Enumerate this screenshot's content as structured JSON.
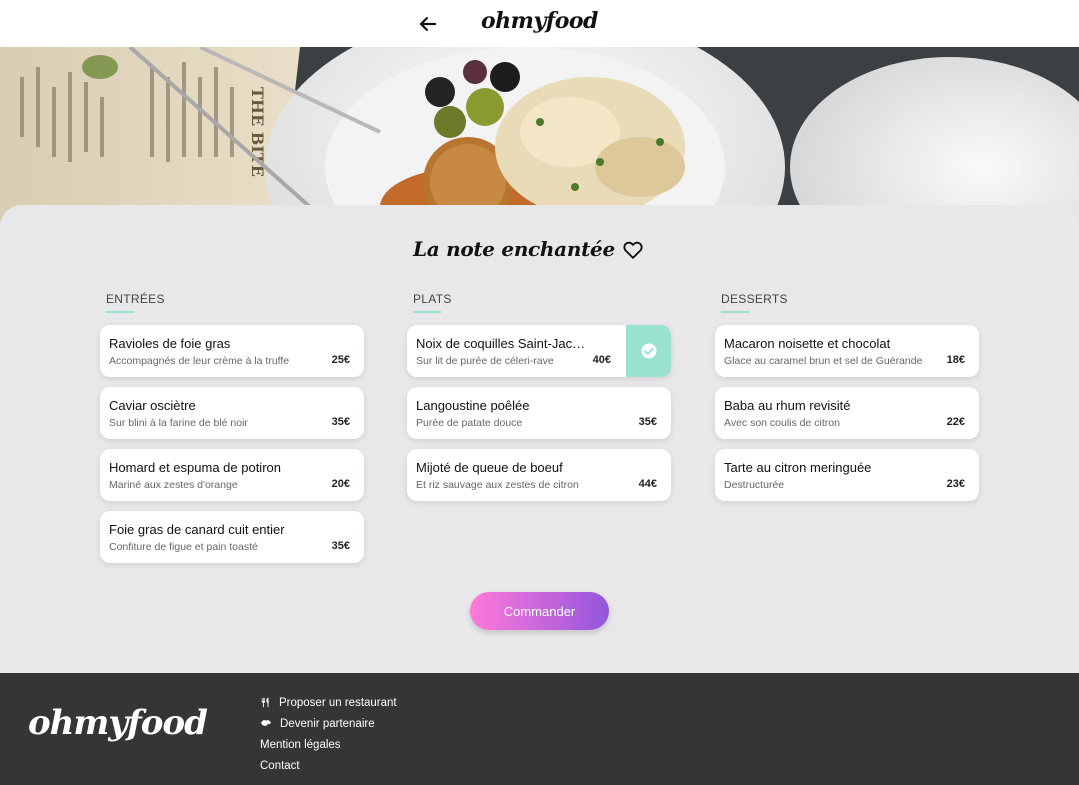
{
  "header": {
    "logo": "ohmyfood"
  },
  "page": {
    "title": "La note enchantée"
  },
  "columns": [
    {
      "title": "ENTRÉES",
      "items": [
        {
          "name": "Ravioles de foie gras",
          "desc": "Accompagnés de leur crème à la truffe",
          "price": "25€"
        },
        {
          "name": "Caviar osciètre",
          "desc": "Sur blini à la farine de blé noir",
          "price": "35€"
        },
        {
          "name": "Homard et espuma de potiron",
          "desc": "Mariné aux zestes d'orange",
          "price": "20€"
        },
        {
          "name": "Foie gras de canard cuit entier",
          "desc": "Confiture de figue et pain toasté",
          "price": "35€"
        }
      ]
    },
    {
      "title": "PLATS",
      "items": [
        {
          "name": "Noix de coquilles Saint-Jacques",
          "desc": "Sur lit de purée de céleri-rave",
          "price": "40€",
          "selected": true
        },
        {
          "name": "Langoustine poêlée",
          "desc": "Purée de patate douce",
          "price": "35€"
        },
        {
          "name": "Mijoté de queue de boeuf",
          "desc": "Et riz sauvage aux zestes de citron",
          "price": "44€"
        }
      ]
    },
    {
      "title": "DESSERTS",
      "items": [
        {
          "name": "Macaron noisette et chocolat",
          "desc": "Glace au caramel brun et sel de Guérande",
          "price": "18€"
        },
        {
          "name": "Baba au rhum revisité",
          "desc": "Avec son coulis de citron",
          "price": "22€"
        },
        {
          "name": "Tarte au citron meringuée",
          "desc": "Destructurée",
          "price": "23€"
        }
      ]
    }
  ],
  "order_button": "Commander",
  "footer": {
    "logo": "ohmyfood",
    "links": [
      {
        "label": "Proposer un restaurant",
        "icon": "utensils-icon"
      },
      {
        "label": "Devenir partenaire",
        "icon": "handshake-icon"
      },
      {
        "label": "Mention légales",
        "icon": ""
      },
      {
        "label": "Contact",
        "icon": ""
      }
    ]
  },
  "colors": {
    "accent": "#99e2d0",
    "gradient_start": "#ff79da",
    "gradient_end": "#9356dc",
    "footer_bg": "#353535"
  }
}
